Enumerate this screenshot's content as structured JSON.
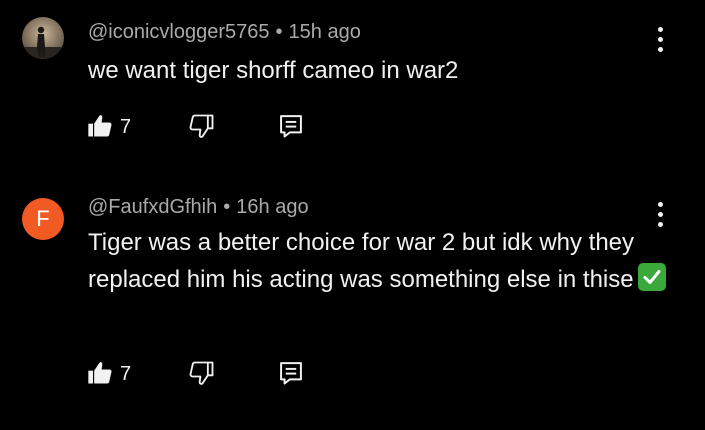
{
  "comments": [
    {
      "username": "@iconicvlogger5765",
      "separator": "•",
      "time": "15h ago",
      "text": "we want tiger shorff cameo in war2",
      "likes": "7",
      "avatar_icon": "profile-photo-icon"
    },
    {
      "username": "@FaufxdGfhih",
      "separator": "•",
      "time": "16h ago",
      "text": "Tiger was a better choice for war 2 but idk why they replaced him his acting was something else in thise",
      "likes": "7",
      "avatar_letter": "F",
      "avatar_color": "#f25a24"
    }
  ],
  "icons": {
    "like": "thumbs-up-icon",
    "dislike": "thumbs-down-icon",
    "reply": "reply-icon",
    "more": "more-vert-icon",
    "check": "check-mark-button-emoji"
  },
  "colors": {
    "background": "#000000",
    "primary_text": "#f1f1f1",
    "secondary_text": "#aaaaaa"
  }
}
